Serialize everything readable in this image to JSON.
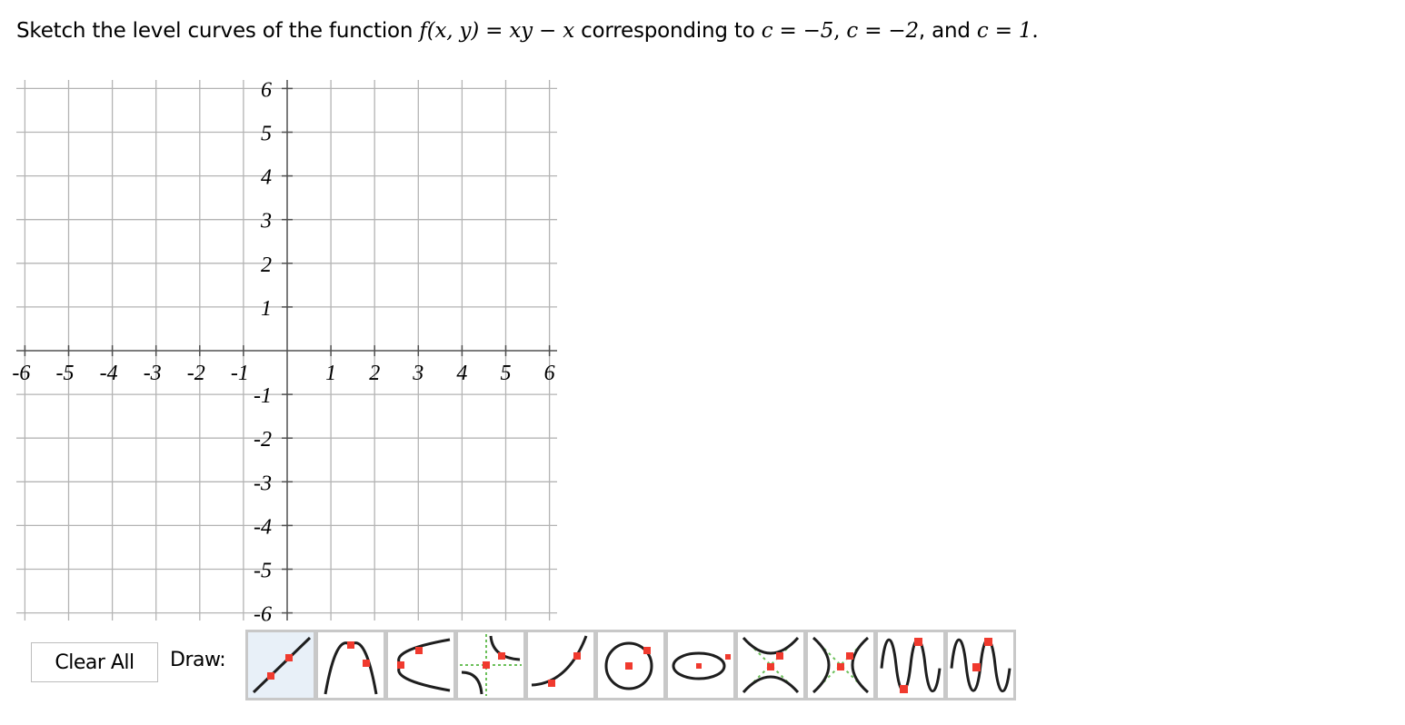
{
  "question": {
    "prefix": "Sketch the level curves of the function ",
    "function_lhs": "f(x, y)",
    "equals": " = ",
    "function_rhs": "xy − x",
    "middle": " corresponding to ",
    "c1": "c = −5",
    "sep1": ", ",
    "c2": "c = −2",
    "sep2": ", and ",
    "c3": "c = 1",
    "suffix": "."
  },
  "graph": {
    "x_range": [
      -6,
      6
    ],
    "y_range": [
      -6,
      6
    ],
    "x_tick_labels": [
      "-6",
      "-5",
      "-4",
      "-3",
      "-2",
      "-1",
      "1",
      "2",
      "3",
      "4",
      "5",
      "6"
    ],
    "y_tick_labels": [
      "6",
      "5",
      "4",
      "3",
      "2",
      "1",
      "-1",
      "-2",
      "-3",
      "-4",
      "-5",
      "-6"
    ],
    "grid_color": "#b4b4b4",
    "axis_color": "#505050"
  },
  "controls": {
    "clear_all_label": "Clear All",
    "draw_label": "Draw:"
  },
  "tools": [
    {
      "name": "line",
      "icon": "line-tool-icon",
      "active": true
    },
    {
      "name": "parabola-vertical",
      "icon": "parabola-vertical-icon",
      "active": false
    },
    {
      "name": "parabola-horizontal",
      "icon": "parabola-horizontal-icon",
      "active": false
    },
    {
      "name": "hyperbola-rational",
      "icon": "rational-hyperbola-icon",
      "active": false
    },
    {
      "name": "exponential",
      "icon": "exponential-icon",
      "active": false
    },
    {
      "name": "circle",
      "icon": "circle-icon",
      "active": false
    },
    {
      "name": "ellipse",
      "icon": "ellipse-icon",
      "active": false
    },
    {
      "name": "hyperbola-vertical",
      "icon": "hyperbola-vertical-icon",
      "active": false
    },
    {
      "name": "hyperbola-horizontal",
      "icon": "hyperbola-horizontal-icon",
      "active": false
    },
    {
      "name": "sine",
      "icon": "sine-icon",
      "active": false
    },
    {
      "name": "cosine",
      "icon": "cosine-icon",
      "active": false
    }
  ],
  "colors": {
    "point": "#f03a2e",
    "curve": "#1e1e1e",
    "asymptote": "#6cc05a",
    "active_tool_bg": "#e8f0f8",
    "tool_border": "#c8c8c8"
  }
}
